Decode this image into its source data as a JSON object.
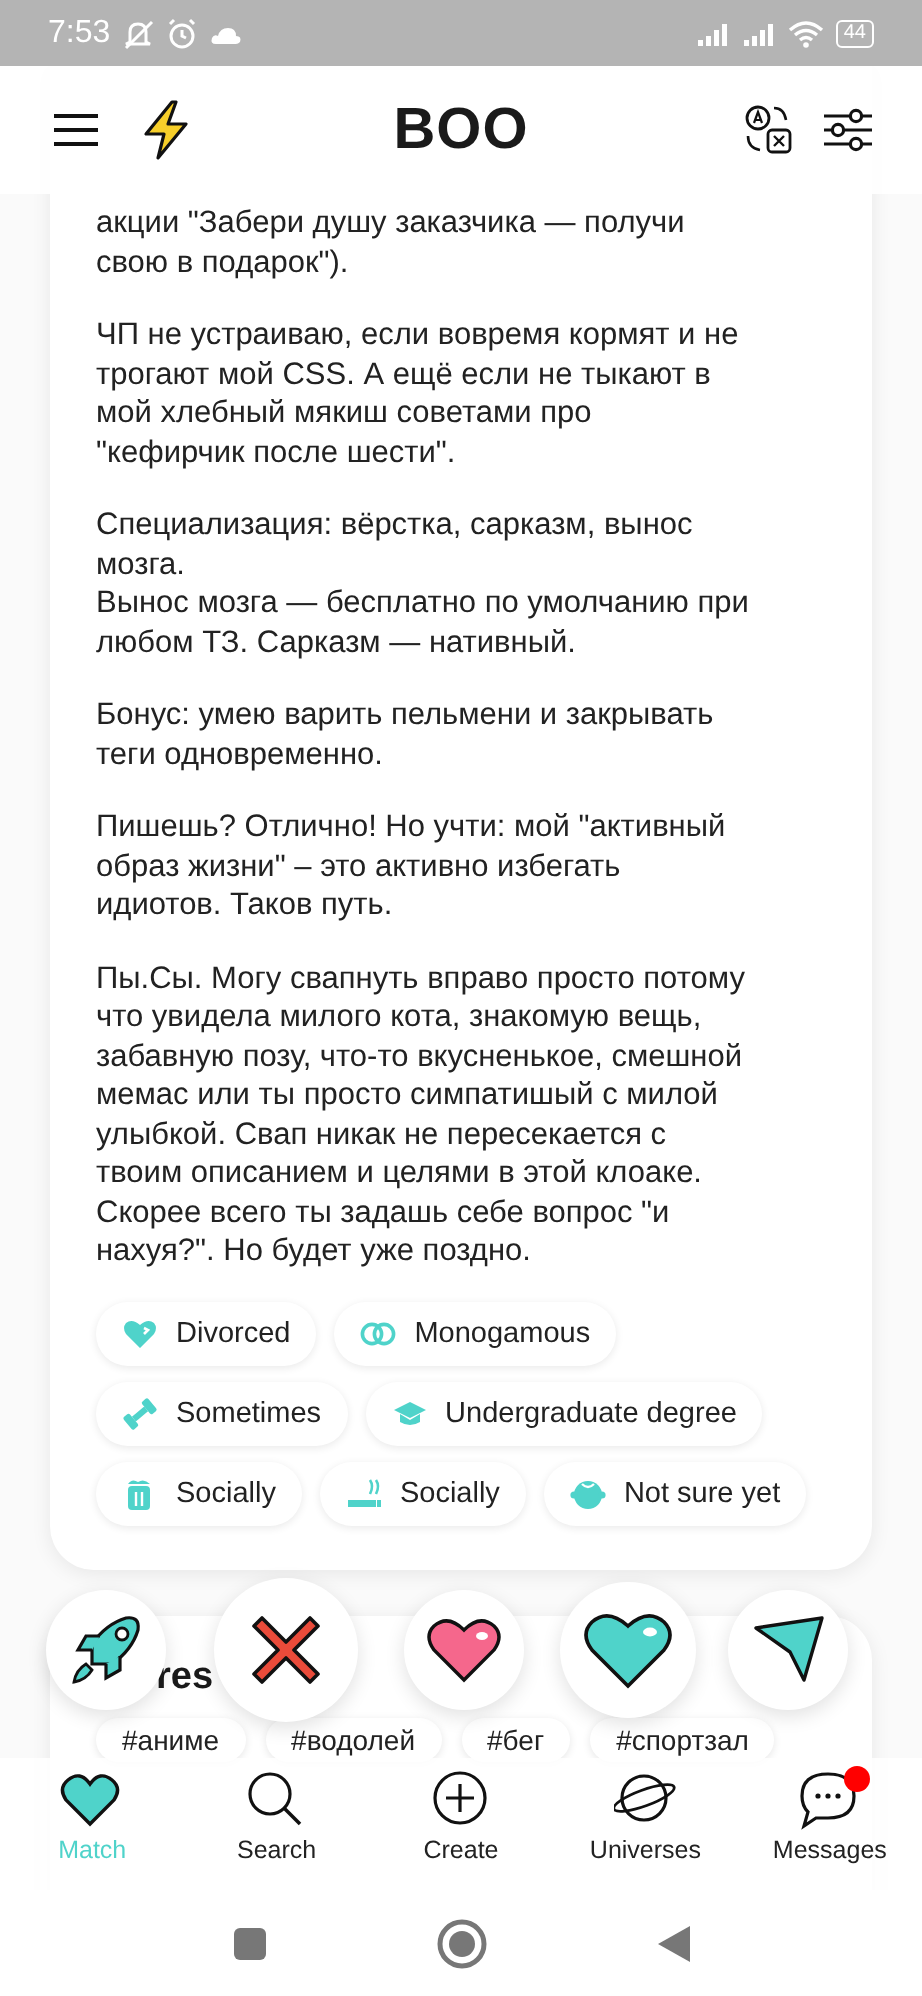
{
  "status_bar": {
    "time": "7:53",
    "battery": "44"
  },
  "header": {
    "logo": "BOO"
  },
  "bio": {
    "paragraphs": [
      "акции \"Забери душу заказчика — получи\nсвою в подарок\").",
      "ЧП не устраиваю, если вовремя кормят и не\nтрогают мой CSS. А ещё если не тыкают в\nмой хлебный мякиш советами про\n\"кефирчик после шести\".",
      "Специализация: вёрстка, сарказм, вынос\nмозга.\nВынос мозга — бесплатно по умолчанию при\nлюбом ТЗ. Сарказм — нативный.",
      "Бонус: умею варить пельмени и закрывать\nтеги одновременно.",
      "Пишешь? Отлично! Но учти: мой \"активный\nобраз жизни\" – это активно избегать\nидиотов. Таков путь.",
      "Пы.Сы. Могу свапнуть вправо просто потому\nчто увидела милого кота, знакомую вещь,\nзабавную позу, что-то вкусненькое, смешной\nмемас или ты просто симпатишый с милой\nулыбкой. Свап никак не пересекается с\nтвоим описанием и целями в этой клоаке.\nСкорее всего ты задашь себе вопрос \"и\nнахуя?\". Но будет уже поздно."
    ]
  },
  "tags": [
    {
      "kind": "relationship",
      "label": "Divorced"
    },
    {
      "kind": "rings",
      "label": "Monogamous"
    },
    {
      "kind": "exercise",
      "label": "Sometimes"
    },
    {
      "kind": "education",
      "label": "Undergraduate degree"
    },
    {
      "kind": "drinking",
      "label": "Socially"
    },
    {
      "kind": "smoking",
      "label": "Socially"
    },
    {
      "kind": "kids",
      "label": "Not sure yet"
    }
  ],
  "interests": {
    "title": "res",
    "hashtags": [
      "#аниме",
      "#водолей",
      "#бег",
      "#спортзал"
    ]
  },
  "actions": [
    {
      "kind": "boost"
    },
    {
      "kind": "pass"
    },
    {
      "kind": "like"
    },
    {
      "kind": "super"
    },
    {
      "kind": "message"
    }
  ],
  "nav": [
    {
      "kind": "match",
      "label": "Match",
      "selected": true,
      "badge": false
    },
    {
      "kind": "search",
      "label": "Search",
      "selected": false,
      "badge": false
    },
    {
      "kind": "create",
      "label": "Create",
      "selected": false,
      "badge": false
    },
    {
      "kind": "universes",
      "label": "Universes",
      "selected": false,
      "badge": false
    },
    {
      "kind": "messages",
      "label": "Messages",
      "selected": false,
      "badge": true
    }
  ]
}
